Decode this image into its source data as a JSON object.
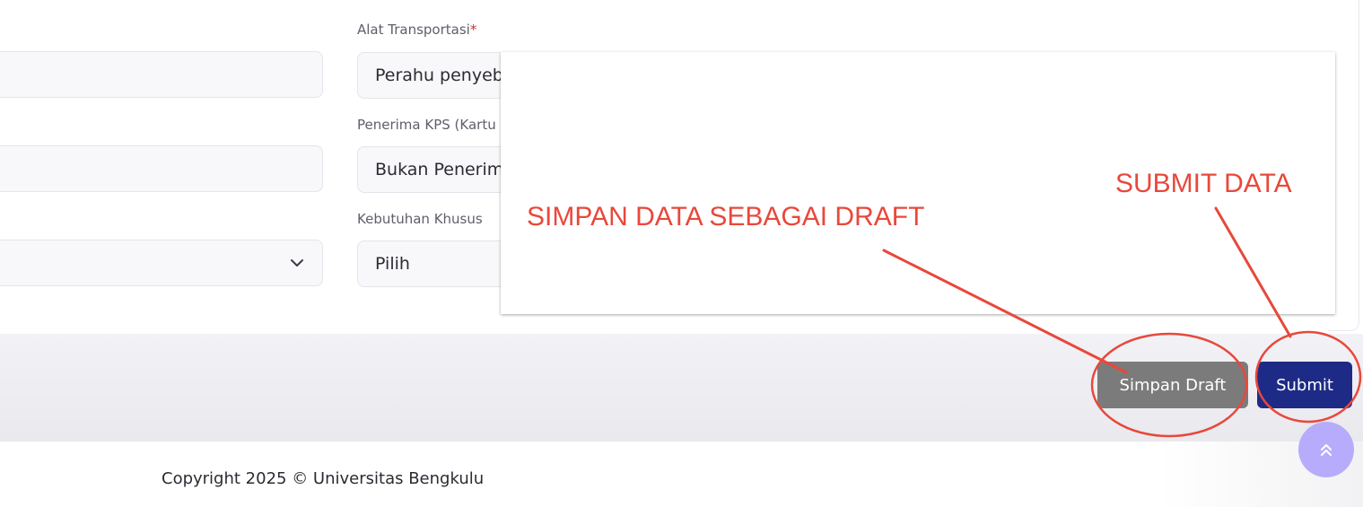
{
  "form": {
    "fields": [
      {
        "label": "Alat Transportasi",
        "required": true,
        "value": "Perahu penyeberangan"
      },
      {
        "label": "Penerima KPS (Kartu Perlindungan Sosial)",
        "required": false,
        "value": "Bukan Penerima"
      },
      {
        "label": "Kebutuhan Khusus",
        "required": false,
        "value": "Pilih"
      }
    ],
    "required_marker": "*"
  },
  "actions": {
    "draft_label": "Simpan Draft",
    "submit_label": "Submit"
  },
  "annotations": {
    "draft_note": "SIMPAN DATA SEBAGAI DRAFT",
    "submit_note": "SUBMIT DATA",
    "color": "#e8483b"
  },
  "footer": {
    "copyright": "Copyright 2025 © Universitas Bengkulu"
  },
  "icons": {
    "select_chevron": "chevron-down-icon",
    "scroll_top": "double-chevron-up-icon"
  },
  "colors": {
    "draft_button": "#7b7b7b",
    "submit_button": "#1d2b86",
    "scroll_top_button": "#b7acfb",
    "required_marker": "#d32f2f"
  }
}
